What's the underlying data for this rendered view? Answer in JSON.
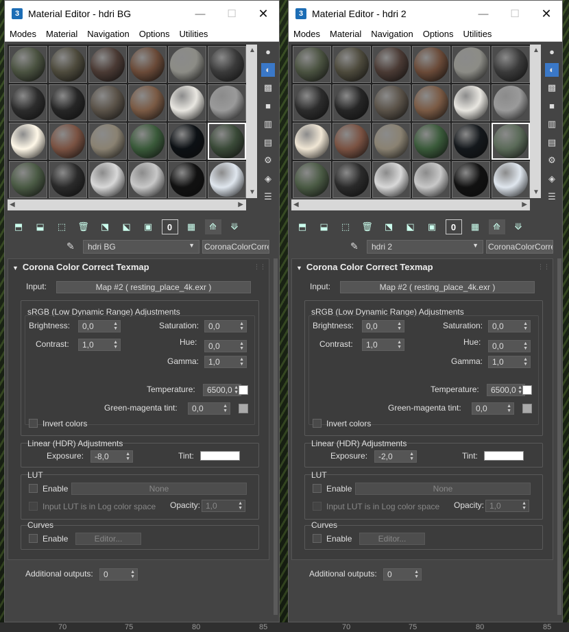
{
  "ruler": {
    "ticks": [
      "70",
      "75",
      "80",
      "85",
      "70",
      "75",
      "80",
      "85"
    ]
  },
  "windows": [
    {
      "title": "Material Editor - hdri BG",
      "app_icon": "3",
      "menu": [
        "Modes",
        "Material",
        "Navigation",
        "Options",
        "Utilities"
      ],
      "material_name": "hdri BG",
      "type_button": "CoronaColorCorre",
      "rollout_title": "Corona Color Correct Texmap",
      "input_label": "Input:",
      "input_map": "Map #2 ( resting_place_4k.exr )",
      "srgb_title": "sRGB (Low Dynamic Range) Adjustments",
      "brightness_label": "Brightness:",
      "brightness": "0,0",
      "saturation_label": "Saturation:",
      "saturation": "0,0",
      "contrast_label": "Contrast:",
      "contrast": "1,0",
      "hue_label": "Hue:",
      "hue": "0,0",
      "gamma_label": "Gamma:",
      "gamma": "1,0",
      "temperature_label": "Temperature:",
      "temperature": "6500,0",
      "gm_label": "Green-magenta tint:",
      "gm_tint": "0,0",
      "invert_label": "Invert colors",
      "linear_title": "Linear (HDR) Adjustments",
      "exposure_label": "Exposure:",
      "exposure": "-8,0",
      "tint_label": "Tint:",
      "lut_title": "LUT",
      "lut_enable_label": "Enable",
      "lut_file": "None",
      "lut_log_label": "Input LUT is in Log color space",
      "opacity_label": "Opacity:",
      "opacity": "1,0",
      "curves_title": "Curves",
      "curves_enable_label": "Enable",
      "curves_editor": "Editor...",
      "additional_label": "Additional outputs:",
      "additional": "0"
    },
    {
      "title": "Material Editor - hdri 2",
      "app_icon": "3",
      "menu": [
        "Modes",
        "Material",
        "Navigation",
        "Options",
        "Utilities"
      ],
      "material_name": "hdri 2",
      "type_button": "CoronaColorCorre",
      "rollout_title": "Corona Color Correct Texmap",
      "input_label": "Input:",
      "input_map": "Map #2 ( resting_place_4k.exr )",
      "srgb_title": "sRGB (Low Dynamic Range) Adjustments",
      "brightness_label": "Brightness:",
      "brightness": "0,0",
      "saturation_label": "Saturation:",
      "saturation": "0,0",
      "contrast_label": "Contrast:",
      "contrast": "1,0",
      "hue_label": "Hue:",
      "hue": "0,0",
      "gamma_label": "Gamma:",
      "gamma": "1,0",
      "temperature_label": "Temperature:",
      "temperature": "6500,0",
      "gm_label": "Green-magenta tint:",
      "gm_tint": "0,0",
      "invert_label": "Invert colors",
      "linear_title": "Linear (HDR) Adjustments",
      "exposure_label": "Exposure:",
      "exposure": "-2,0",
      "tint_label": "Tint:",
      "lut_title": "LUT",
      "lut_enable_label": "Enable",
      "lut_file": "None",
      "lut_log_label": "Input LUT is in Log color space",
      "opacity_label": "Opacity:",
      "opacity": "1,0",
      "curves_title": "Curves",
      "curves_enable_label": "Enable",
      "curves_editor": "Editor...",
      "additional_label": "Additional outputs:",
      "additional": "0"
    }
  ],
  "sample_slots_w1": [
    "#4a5240",
    "#4d4a3c",
    "#4a3a34",
    "#6a4a38",
    "#8c8c86",
    "#3a3a3a",
    "#2c2c2c",
    "#262626",
    "#5a5248",
    "#7a5a44",
    "#e8e6e0",
    "#9a9a9a",
    "#fff8e8",
    "#7a5242",
    "#8a8272",
    "#3a5a3a",
    "#0c1014",
    "#3a4a38",
    "#4a5a44",
    "#2a2a2a",
    "#d8d8d8",
    "#c8c8c8",
    "#111111",
    "#dfe6ee"
  ],
  "sample_slots_w2": [
    "#4a5240",
    "#4d4a3c",
    "#4a3a34",
    "#6a4a38",
    "#8c8c86",
    "#3a3a3a",
    "#2c2c2c",
    "#262626",
    "#5a5248",
    "#7a5a44",
    "#e8e6e0",
    "#9a9a9a",
    "#f0e6d4",
    "#7a5242",
    "#8a8272",
    "#3a5a3a",
    "#14181c",
    "#5a6a58",
    "#4a5a44",
    "#2a2a2a",
    "#d8d8d8",
    "#c8c8c8",
    "#111111",
    "#dfe6ee"
  ],
  "sidebar_icons": [
    "sample-type-icon",
    "backlight-icon",
    "background-icon",
    "uv-tiling-icon",
    "video-check-icon",
    "make-preview-icon",
    "options-icon",
    "select-by-material-icon",
    "material-navigator-icon"
  ],
  "toolbar_icons": [
    "get-material-icon",
    "put-to-scene-icon",
    "assign-to-selection-icon",
    "reset-map-icon",
    "make-unique-icon",
    "put-to-library-icon",
    "material-id-icon",
    "show-in-viewport-icon",
    "show-end-result-icon",
    "go-to-parent-icon",
    "go-forward-to-sibling-icon"
  ],
  "toolbar_glyphs": [
    "⬒",
    "⬓",
    "⬚",
    "🗑",
    "⬔",
    "⬕",
    "▣",
    "0",
    "▦",
    "⟰",
    "⟱"
  ],
  "sidebar_glyphs": [
    "●",
    "◐",
    "▩",
    "■",
    "▥",
    "▤",
    "⚙",
    "◈",
    "☰"
  ]
}
